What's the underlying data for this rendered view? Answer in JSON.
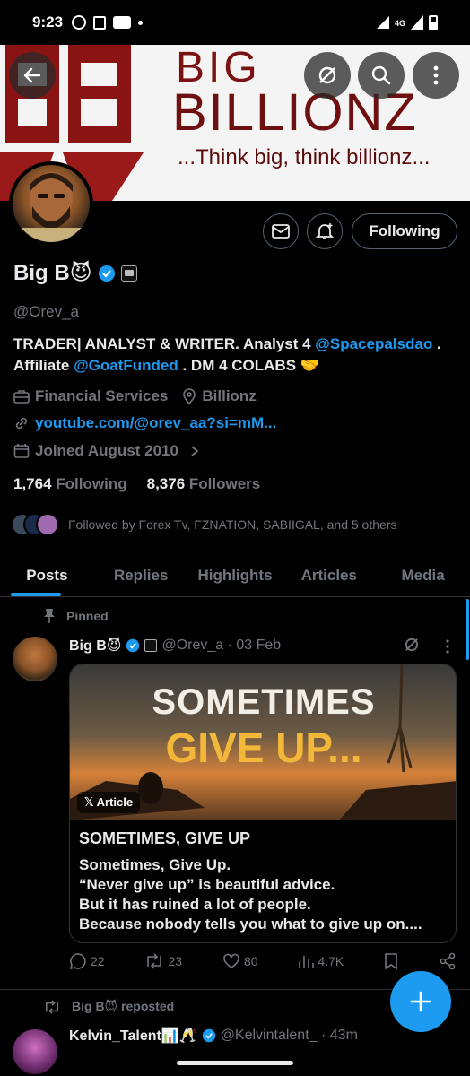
{
  "status_bar": {
    "time": "9:23",
    "network": "4G"
  },
  "banner": {
    "big_text": "BIG",
    "brand_text": "BILLIONZ",
    "tagline": "...Think big, think billionz..."
  },
  "profile": {
    "following_button": "Following",
    "name": "Big B😈",
    "handle": "@Orev_a",
    "bio_part1": "TRADER| ANALYST & WRITER. Analyst 4 ",
    "bio_link1": "@Spacepalsdao",
    "bio_part2": " . Affiliate ",
    "bio_link2": "@GoatFunded",
    "bio_part3": " . DM 4 COLABS 🤝",
    "category": "Financial Services",
    "location": "Billionz",
    "website": "youtube.com/@orev_aa?si=mM...",
    "joined": "Joined August 2010",
    "following_count": "1,764",
    "following_label": "Following",
    "followers_count": "8,376",
    "followers_label": "Followers",
    "followed_by": "Followed by Forex Tv, FZNATION, SABIIGAL, and 5 others"
  },
  "tabs": [
    "Posts",
    "Replies",
    "Highlights",
    "Articles",
    "Media"
  ],
  "pinned_post": {
    "pinned_label": "Pinned",
    "author": "Big B😈",
    "handle_date": "@Orev_a · 03 Feb",
    "card": {
      "image_line1": "SOMETIMES",
      "image_line2": "GIVE UP...",
      "badge": "Article",
      "title": "SOMETIMES, GIVE UP",
      "lines": [
        "Sometimes, Give Up.",
        "“Never give up” is beautiful advice.",
        "But it has ruined a lot of people.",
        "Because nobody tells you what to give up on...."
      ]
    },
    "replies": "22",
    "reposts": "23",
    "likes": "80",
    "views": "4.7K"
  },
  "repost_item": {
    "repost_label": "Big B😈 reposted",
    "author": "Kelvin_Talent📊🥂",
    "handle_time": "@Kelvintalent_ · 43m"
  },
  "colors": {
    "accent": "#1d9bf0",
    "background": "#000000",
    "muted": "#71767b",
    "banner_red": "#7a1212"
  }
}
